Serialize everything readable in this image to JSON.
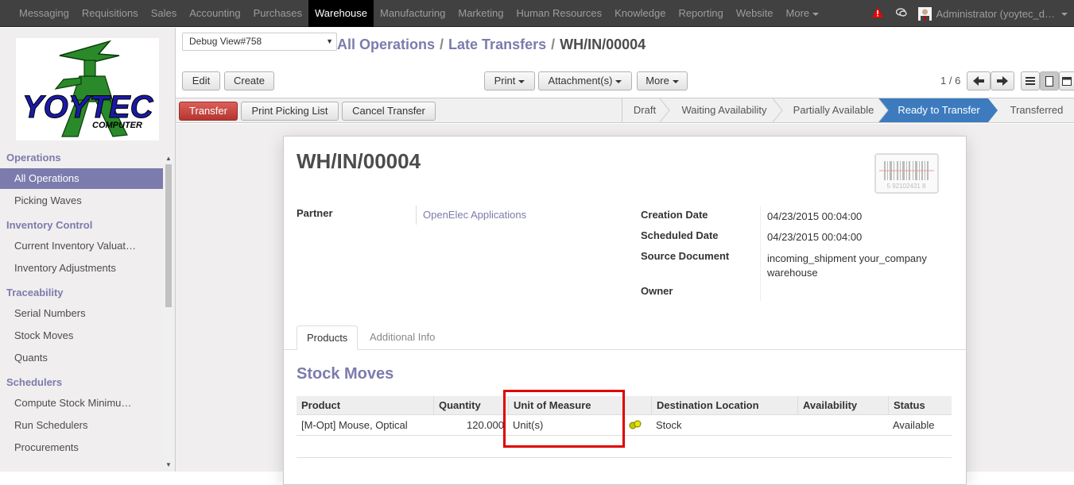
{
  "topnav": {
    "items": [
      "Messaging",
      "Requisitions",
      "Sales",
      "Accounting",
      "Purchases",
      "Warehouse",
      "Manufacturing",
      "Marketing",
      "Human Resources",
      "Knowledge",
      "Reporting",
      "Website",
      "More"
    ],
    "active": "Warehouse",
    "user": "Administrator (yoytec_d…"
  },
  "sidebar": {
    "logo_text": "YOYTEC",
    "logo_sub": "COMPUTER",
    "sections": [
      {
        "title": "Operations",
        "items": [
          "All Operations",
          "Picking Waves"
        ]
      },
      {
        "title": "Inventory Control",
        "items": [
          "Current Inventory Valuat…",
          "Inventory Adjustments"
        ]
      },
      {
        "title": "Traceability",
        "items": [
          "Serial Numbers",
          "Stock Moves",
          "Quants"
        ]
      },
      {
        "title": "Schedulers",
        "items": [
          "Compute Stock Minimu…",
          "Run Schedulers",
          "Procurements"
        ]
      }
    ],
    "active_item": "All Operations"
  },
  "debug_select": "Debug View#758",
  "breadcrumb": {
    "first": "All Operations",
    "second": "Late Transfers",
    "current": "WH/IN/00004"
  },
  "toolbar": {
    "edit": "Edit",
    "create": "Create",
    "print": "Print",
    "attachments": "Attachment(s)",
    "more": "More",
    "pager": "1 / 6"
  },
  "actions": {
    "transfer": "Transfer",
    "print_picking": "Print Picking List",
    "cancel": "Cancel Transfer"
  },
  "stages": [
    "Draft",
    "Waiting Availability",
    "Partially Available",
    "Ready to Transfer",
    "Transferred"
  ],
  "current_stage": "Ready to Transfer",
  "record": {
    "title": "WH/IN/00004",
    "barcode_digits": "5 92102431 8",
    "partner_label": "Partner",
    "partner_value": "OpenElec Applications",
    "creation_label": "Creation Date",
    "creation_value": "04/23/2015 00:04:00",
    "scheduled_label": "Scheduled Date",
    "scheduled_value": "04/23/2015 00:04:00",
    "source_label": "Source Document",
    "source_value": "incoming_shipment your_company warehouse",
    "owner_label": "Owner"
  },
  "tabs": [
    "Products",
    "Additional Info"
  ],
  "stock_moves": {
    "title": "Stock Moves",
    "columns": [
      "Product",
      "Quantity",
      "Unit of Measure",
      "",
      "Destination Location",
      "Availability",
      "Status"
    ],
    "rows": [
      {
        "product": "[M-Opt] Mouse, Optical",
        "quantity": "120.000",
        "uom": "Unit(s)",
        "destination": "Stock",
        "availability": "",
        "status": "Available"
      }
    ]
  },
  "colors": {
    "accent": "#7c7bad",
    "highlight_box": "#e00000",
    "current_stage": "#3d7bbe",
    "transfer_btn": "#c9302c"
  }
}
